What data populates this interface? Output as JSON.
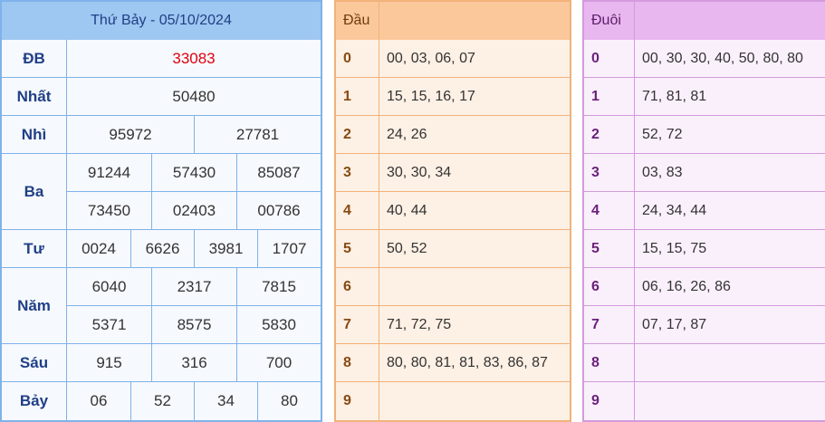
{
  "results": {
    "title": "Thứ Bảy - 05/10/2024",
    "prizes": [
      {
        "label": "ĐB",
        "values": [
          "33083"
        ]
      },
      {
        "label": "Nhất",
        "values": [
          "50480"
        ]
      },
      {
        "label": "Nhì",
        "values": [
          "95972",
          "27781"
        ]
      },
      {
        "label": "Ba",
        "values": [
          "91244",
          "57430",
          "85087",
          "73450",
          "02403",
          "00786"
        ]
      },
      {
        "label": "Tư",
        "values": [
          "0024",
          "6626",
          "3981",
          "1707"
        ]
      },
      {
        "label": "Năm",
        "values": [
          "6040",
          "2317",
          "7815",
          "5371",
          "8575",
          "5830"
        ]
      },
      {
        "label": "Sáu",
        "values": [
          "915",
          "316",
          "700"
        ]
      },
      {
        "label": "Bảy",
        "values": [
          "06",
          "52",
          "34",
          "80"
        ]
      }
    ]
  },
  "dau": {
    "header": "Đầu",
    "rows": [
      {
        "digit": "0",
        "values": "00, 03, 06, 07"
      },
      {
        "digit": "1",
        "values": "15, 15, 16, 17"
      },
      {
        "digit": "2",
        "values": "24, 26"
      },
      {
        "digit": "3",
        "values": "30, 30, 34"
      },
      {
        "digit": "4",
        "values": "40, 44"
      },
      {
        "digit": "5",
        "values": "50, 52"
      },
      {
        "digit": "6",
        "values": ""
      },
      {
        "digit": "7",
        "values": "71, 72, 75"
      },
      {
        "digit": "8",
        "values": "80, 80, 81, 81, 83, 86, 87"
      },
      {
        "digit": "9",
        "values": ""
      }
    ]
  },
  "duoi": {
    "header": "Đuôi",
    "rows": [
      {
        "digit": "0",
        "values": "00, 30, 30, 40, 50, 80, 80"
      },
      {
        "digit": "1",
        "values": "71, 81, 81"
      },
      {
        "digit": "2",
        "values": "52, 72"
      },
      {
        "digit": "3",
        "values": "03, 83"
      },
      {
        "digit": "4",
        "values": "24, 34, 44"
      },
      {
        "digit": "5",
        "values": "15, 15, 75"
      },
      {
        "digit": "6",
        "values": "06, 16, 26, 86"
      },
      {
        "digit": "7",
        "values": "07, 17, 87"
      },
      {
        "digit": "8",
        "values": ""
      },
      {
        "digit": "9",
        "values": ""
      }
    ]
  }
}
